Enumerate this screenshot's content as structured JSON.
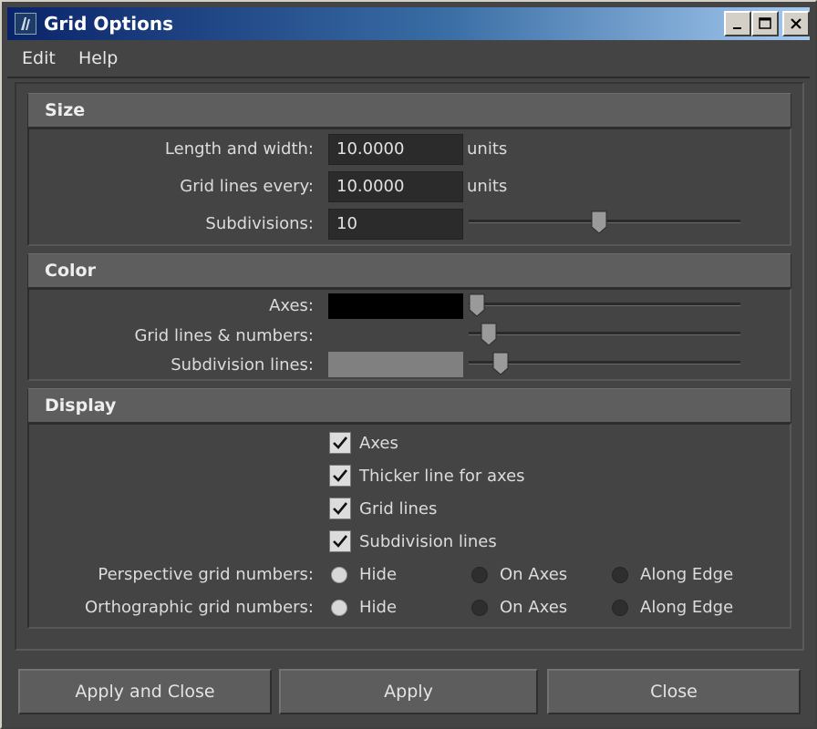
{
  "window": {
    "title": "Grid Options"
  },
  "menu": {
    "edit": "Edit",
    "help": "Help"
  },
  "sections": {
    "size": {
      "header": "Size",
      "length_label": "Length and width:",
      "length_value": "10.0000",
      "length_unit": "units",
      "gridlines_label": "Grid lines every:",
      "gridlines_value": "10.0000",
      "gridlines_unit": "units",
      "subdiv_label": "Subdivisions:",
      "subdiv_value": "10"
    },
    "color": {
      "header": "Color",
      "axes_label": "Axes:",
      "axes_color": "#000000",
      "gridnum_label": "Grid lines & numbers:",
      "gridnum_color": "#444444",
      "subdiv_label": "Subdivision lines:",
      "subdiv_color": "#808080"
    },
    "display": {
      "header": "Display",
      "checkboxes": [
        {
          "label": "Axes",
          "checked": true
        },
        {
          "label": "Thicker line for axes",
          "checked": true
        },
        {
          "label": "Grid lines",
          "checked": true
        },
        {
          "label": "Subdivision lines",
          "checked": true
        }
      ],
      "persp_label": "Perspective grid numbers:",
      "ortho_label": "Orthographic grid numbers:",
      "options": [
        "Hide",
        "On Axes",
        "Along Edge"
      ],
      "persp_selected": "Hide",
      "ortho_selected": "Hide"
    }
  },
  "buttons": {
    "apply_close": "Apply and Close",
    "apply": "Apply",
    "close": "Close"
  }
}
